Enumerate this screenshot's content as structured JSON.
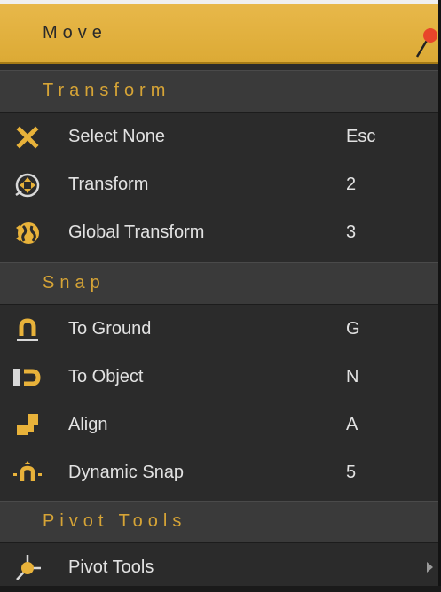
{
  "title": "Move",
  "sections": [
    {
      "label": "Transform",
      "items": [
        {
          "label": "Select None",
          "shortcut": "Esc",
          "icon": "x-icon"
        },
        {
          "label": "Transform",
          "shortcut": "2",
          "icon": "transform-icon"
        },
        {
          "label": "Global Transform",
          "shortcut": "3",
          "icon": "globe-icon"
        }
      ]
    },
    {
      "label": "Snap",
      "items": [
        {
          "label": "To Ground",
          "shortcut": "G",
          "icon": "magnet-ground-icon"
        },
        {
          "label": "To Object",
          "shortcut": "N",
          "icon": "magnet-object-icon"
        },
        {
          "label": "Align",
          "shortcut": "A",
          "icon": "align-icon"
        },
        {
          "label": "Dynamic Snap",
          "shortcut": "5",
          "icon": "dynamic-snap-icon"
        }
      ]
    },
    {
      "label": "Pivot Tools",
      "items": [
        {
          "label": "Pivot Tools",
          "shortcut": "",
          "icon": "pivot-icon",
          "has_submenu": true
        }
      ]
    }
  ],
  "colors": {
    "accent": "#dcaa35",
    "section_text": "#d6a436",
    "background": "#2b2b2b",
    "section_bg": "#3a3a3a",
    "text": "#e2e2e2"
  }
}
